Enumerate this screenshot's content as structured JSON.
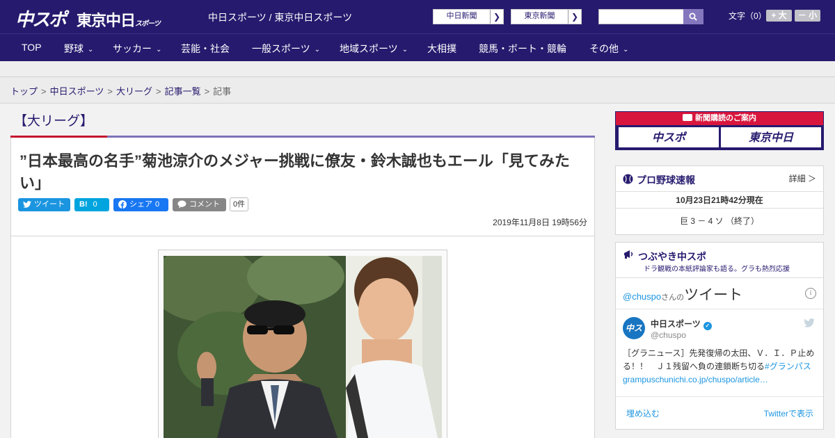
{
  "header": {
    "logo_chuspo": "中スポ",
    "logo_tokyo": "東京中日",
    "logo_tokyo_small": "スポーツ",
    "title": "中日スポーツ / 東京中日スポーツ",
    "site_links": [
      {
        "label": "中日新聞"
      },
      {
        "label": "東京新聞"
      }
    ],
    "search": {
      "placeholder": ""
    },
    "font_size_label": "文字（0）",
    "font_up": "+ 大",
    "font_down": "－ 小"
  },
  "nav": {
    "items": [
      {
        "label": "TOP",
        "has_menu": false
      },
      {
        "label": "野球",
        "has_menu": true
      },
      {
        "label": "サッカー",
        "has_menu": true
      },
      {
        "label": "芸能・社会",
        "has_menu": false
      },
      {
        "label": "一般スポーツ",
        "has_menu": true
      },
      {
        "label": "地域スポーツ",
        "has_menu": true
      },
      {
        "label": "大相撲",
        "has_menu": false
      },
      {
        "label": "競馬・ボート・競輪",
        "has_menu": false
      },
      {
        "label": "その他",
        "has_menu": true
      }
    ]
  },
  "breadcrumb": {
    "items": [
      "トップ",
      "中日スポーツ",
      "大リーグ",
      "記事一覧"
    ],
    "current": "記事"
  },
  "article": {
    "category": "【大リーグ】",
    "headline": "”日本最高の名手”菊池涼介のメジャー挑戦に僚友・鈴木誠也もエール「見てみたい」",
    "share": {
      "tweet": "ツイート",
      "hatena_icon": "B!",
      "hatena_count": "0",
      "facebook": "シェア",
      "facebook_count": "0",
      "comment": "コメント",
      "comment_count": "0件"
    },
    "date": "2019年11月8日 19時56分"
  },
  "sidebar": {
    "ad": {
      "head": "新聞購読のご案内",
      "logo1": "中スポ",
      "logo2": "東京中日"
    },
    "baseball": {
      "title": "プロ野球速報",
      "detail": "詳細 ＞",
      "time": "10月23日21時42分現在",
      "score": "巨  3 － 4  ソ  （終了）"
    },
    "tweets": {
      "title": "つぶやき中スポ",
      "subtitle": "ドラ観戦の本紙評論家も語る。グラも熱烈応援",
      "handle_link": "@chuspo",
      "san_no": "さんの",
      "tweets_label": "ツイート",
      "avatar_text": "中スポ",
      "name": "中日スポーツ",
      "account": "@chuspo",
      "text_plain": "［グラニュース］先発復帰の太田、Ｖ．Ｉ．Ｐ止める！！　Ｊ１残留へ負の連鎖断ち切る",
      "text_hashtag": "#グランパス",
      "text_link": "grampuschunichi.co.jp/chuspo/article…",
      "embed_label": "埋め込む",
      "view_label": "Twitterで表示"
    }
  },
  "colors": {
    "brand": "#261a6e",
    "accent_red": "#c4132c",
    "twitter": "#1b95e0"
  }
}
